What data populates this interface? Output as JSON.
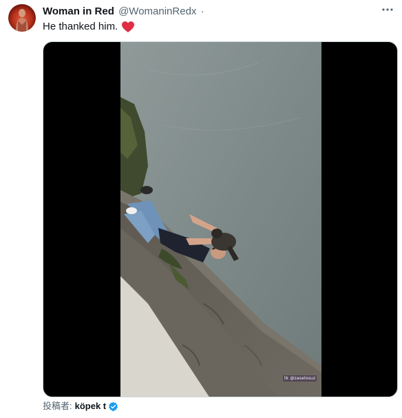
{
  "tweet": {
    "display_name": "Woman in Red",
    "handle": "@WomaninRedx",
    "separator": "·",
    "text": "He thanked him.",
    "emoji": "heart-emoji-red"
  },
  "media": {
    "watermark": "tk @zaselosuz"
  },
  "footer": {
    "posted_by_label": "投稿者:",
    "author": "köpek t",
    "verified_icon": "verified-badge-icon"
  },
  "colors": {
    "text_primary": "#0f1419",
    "text_secondary": "#536471",
    "heart": "#e0245e",
    "verified": "#1d9bf0"
  }
}
